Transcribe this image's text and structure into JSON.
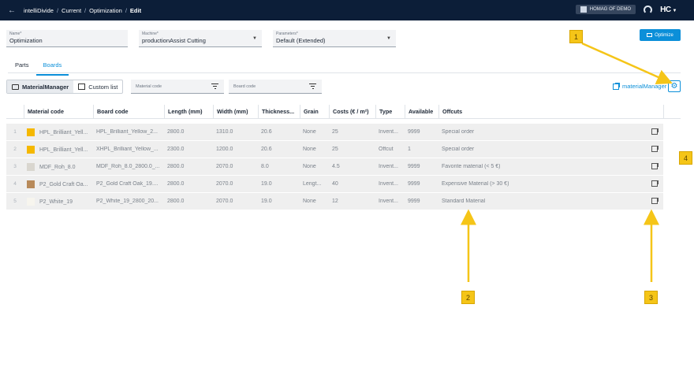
{
  "header": {
    "breadcrumbs": [
      "intelliDivide",
      "Current",
      "Optimization",
      "Edit"
    ],
    "separator": "/",
    "demo_label": "HOMAG OF DEMO",
    "logo_text": "HC"
  },
  "form": {
    "name": {
      "label": "Name*",
      "value": "Optimization"
    },
    "machine": {
      "label": "Machine*",
      "value": "productionAssist Cutting"
    },
    "parameters": {
      "label": "Parameters*",
      "value": "Default (Extended)"
    },
    "optimize_label": "Optimize"
  },
  "tabs": [
    {
      "label": "Parts",
      "active": false
    },
    {
      "label": "Boards",
      "active": true
    }
  ],
  "toolbar": {
    "material_manager_label": "MaterialManager",
    "custom_list_label": "Custom list",
    "material_code_placeholder": "Material code",
    "board_code_placeholder": "Board code",
    "material_manager_link": "materialManager"
  },
  "table": {
    "headers": [
      "Material code",
      "Board code",
      "Length (mm)",
      "Width (mm)",
      "Thickness...",
      "Grain",
      "Costs (€ / m²)",
      "Type",
      "Available",
      "Offcuts"
    ],
    "rows": [
      {
        "num": "1",
        "swatch": "#f5b800",
        "material": "HPL_Brilliant_Yell...",
        "board": "HPL_Brilliant_Yellow_2...",
        "length": "2800.0",
        "width": "1310.0",
        "thickness": "20.6",
        "grain": "None",
        "costs": "25",
        "type": "Invent...",
        "available": "9999",
        "offcuts": "Special order"
      },
      {
        "num": "2",
        "swatch": "#f5b800",
        "material": "HPL_Brilliant_Yell...",
        "board": "XHPL_Brilliant_Yellow_...",
        "length": "2300.0",
        "width": "1200.0",
        "thickness": "20.6",
        "grain": "None",
        "costs": "25",
        "type": "Offcut",
        "available": "1",
        "offcuts": "Special order"
      },
      {
        "num": "3",
        "swatch": "#d9d6cf",
        "material": "MDF_Roh_8.0",
        "board": "MDF_Roh_8.0_2800.0_...",
        "length": "2800.0",
        "width": "2070.0",
        "thickness": "8.0",
        "grain": "None",
        "costs": "4.5",
        "type": "Invent...",
        "available": "9999",
        "offcuts": "Favorite material (< 5 €)"
      },
      {
        "num": "4",
        "swatch": "#b88a5a",
        "material": "P2_Gold Craft Oa...",
        "board": "P2_Gold Craft Oak_19....",
        "length": "2800.0",
        "width": "2070.0",
        "thickness": "19.0",
        "grain": "Lengt...",
        "costs": "40",
        "type": "Invent...",
        "available": "9999",
        "offcuts": "Expensive Material (> 30 €)"
      },
      {
        "num": "5",
        "swatch": "#f7f5ee",
        "material": "P2_White_19",
        "board": "P2_White_19_2800_20...",
        "length": "2800.0",
        "width": "2070.0",
        "thickness": "19.0",
        "grain": "None",
        "costs": "12",
        "type": "Invent...",
        "available": "9999",
        "offcuts": "Standard Material"
      }
    ]
  },
  "annotations": [
    "1",
    "2",
    "3",
    "4"
  ],
  "colors": {
    "accent": "#0b8fd9",
    "topbar": "#0c1e38",
    "annotation": "#f5c518"
  }
}
